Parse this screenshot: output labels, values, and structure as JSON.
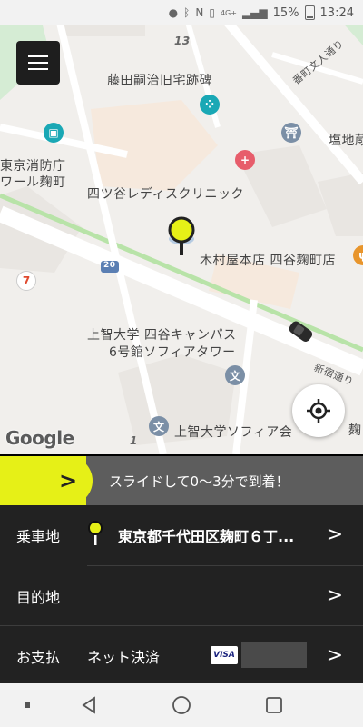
{
  "status_bar": {
    "time": "13:24",
    "battery": "15%",
    "network_badge": "4G+"
  },
  "map": {
    "labels": {
      "fujita": "藤田嗣治旧宅跡碑",
      "shiomi": "塩地蔵",
      "fire": "東京消防庁",
      "fire2": "ワール麹町",
      "clinic": "四ツ谷レディスクリニック",
      "kimuraya": "木村屋本店 四谷麹町店",
      "sophia1": "上智大学 四谷キャンパス",
      "sophia2": "6号館ソフィアタワー",
      "sophia_hall": "上智大学ソフィア会",
      "bancho": "番町文人通り",
      "shinjuku": "新宿通り",
      "koji": "麹",
      "block13": "13",
      "block1": "1",
      "route20": "20"
    },
    "google_logo": "Google"
  },
  "slide": {
    "text": "スライドして0〜3分で到着！",
    "knob_icon": ">"
  },
  "rows": {
    "pickup_label": "乗車地",
    "pickup_value": "東京都千代田区麹町６丁...",
    "destination_label": "目的地",
    "payment_label": "お支払",
    "payment_value": "ネット決済",
    "card_brand": "VISA",
    "chevron": ">"
  },
  "colors": {
    "accent_yellow": "#e6f017",
    "panel_dark": "#222222",
    "slide_gray": "#5d5d5d"
  },
  "icons": {
    "menu": "hamburger-menu-icon",
    "locate": "my-location-icon",
    "pin": "map-pin-icon",
    "car": "taxi-car-icon"
  }
}
